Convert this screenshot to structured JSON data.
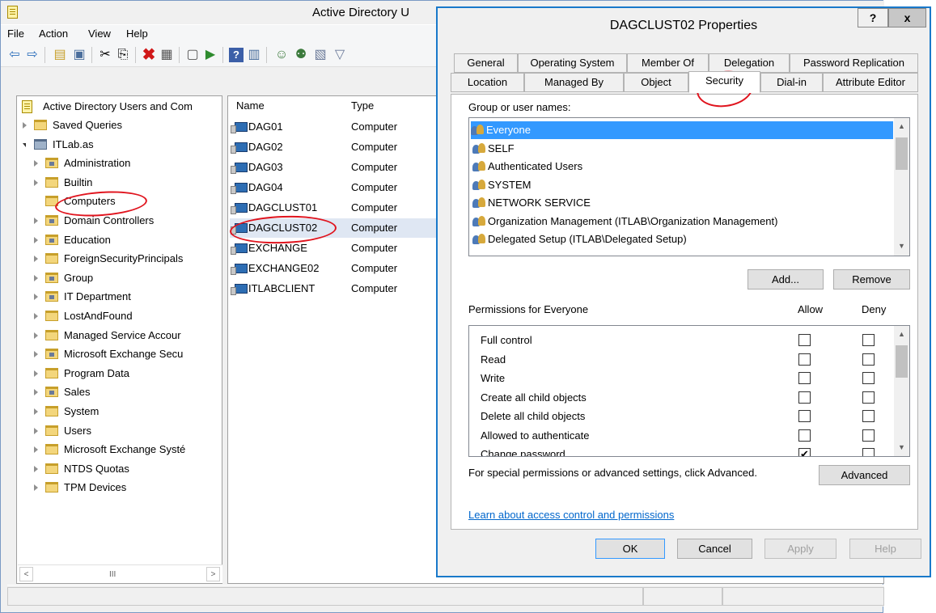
{
  "mmc": {
    "title": "Active Directory U",
    "menu": [
      "File",
      "Action",
      "View",
      "Help"
    ],
    "tree": {
      "root": "Active Directory Users and Com",
      "items": [
        {
          "label": "Saved Queries",
          "level": 1,
          "expander": "closed",
          "icon": "folder"
        },
        {
          "label": "ITLab.as",
          "level": 1,
          "expander": "open",
          "icon": "domain"
        },
        {
          "label": "Administration",
          "level": 2,
          "expander": "closed",
          "icon": "ou"
        },
        {
          "label": "Builtin",
          "level": 2,
          "expander": "closed",
          "icon": "folder"
        },
        {
          "label": "Computers",
          "level": 2,
          "expander": "none",
          "icon": "folder",
          "selected": true
        },
        {
          "label": "Domain Controllers",
          "level": 2,
          "expander": "closed",
          "icon": "ou"
        },
        {
          "label": "Education",
          "level": 2,
          "expander": "closed",
          "icon": "ou"
        },
        {
          "label": "ForeignSecurityPrincipals",
          "level": 2,
          "expander": "closed",
          "icon": "folder"
        },
        {
          "label": "Group",
          "level": 2,
          "expander": "closed",
          "icon": "ou"
        },
        {
          "label": "IT Department",
          "level": 2,
          "expander": "closed",
          "icon": "ou"
        },
        {
          "label": "LostAndFound",
          "level": 2,
          "expander": "closed",
          "icon": "folder"
        },
        {
          "label": "Managed Service Accour",
          "level": 2,
          "expander": "closed",
          "icon": "folder"
        },
        {
          "label": "Microsoft Exchange Secu",
          "level": 2,
          "expander": "closed",
          "icon": "ou"
        },
        {
          "label": "Program Data",
          "level": 2,
          "expander": "closed",
          "icon": "folder"
        },
        {
          "label": "Sales",
          "level": 2,
          "expander": "closed",
          "icon": "ou"
        },
        {
          "label": "System",
          "level": 2,
          "expander": "closed",
          "icon": "folder"
        },
        {
          "label": "Users",
          "level": 2,
          "expander": "closed",
          "icon": "folder"
        },
        {
          "label": "Microsoft Exchange Systé",
          "level": 2,
          "expander": "closed",
          "icon": "folder"
        },
        {
          "label": "NTDS Quotas",
          "level": 2,
          "expander": "closed",
          "icon": "folder"
        },
        {
          "label": "TPM Devices",
          "level": 2,
          "expander": "closed",
          "icon": "folder"
        }
      ],
      "scroll_left": "<",
      "scroll_thumb": "III",
      "scroll_right": ">"
    },
    "list": {
      "col_name": "Name",
      "col_type": "Type",
      "rows": [
        {
          "name": "DAG01",
          "type": "Computer"
        },
        {
          "name": "DAG02",
          "type": "Computer"
        },
        {
          "name": "DAG03",
          "type": "Computer"
        },
        {
          "name": "DAG04",
          "type": "Computer"
        },
        {
          "name": "DAGCLUST01",
          "type": "Computer"
        },
        {
          "name": "DAGCLUST02",
          "type": "Computer",
          "selected": true
        },
        {
          "name": "EXCHANGE",
          "type": "Computer"
        },
        {
          "name": "EXCHANGE02",
          "type": "Computer"
        },
        {
          "name": "ITLABCLIENT",
          "type": "Computer"
        }
      ]
    }
  },
  "dialog": {
    "title": "DAGCLUST02 Properties",
    "help": "?",
    "close": "x",
    "tabs_row1": [
      "General",
      "Operating System",
      "Member Of",
      "Delegation",
      "Password Replication"
    ],
    "tabs_row2": [
      "Location",
      "Managed By",
      "Object",
      "Security",
      "Dial-in",
      "Attribute Editor"
    ],
    "active_tab": "Security",
    "group_label": "Group or user names:",
    "groups": [
      "Everyone",
      "SELF",
      "Authenticated Users",
      "SYSTEM",
      "NETWORK SERVICE",
      "Organization Management (ITLAB\\Organization Management)",
      "Delegated Setup (ITLAB\\Delegated Setup)"
    ],
    "add": "Add...",
    "remove": "Remove",
    "perm_label": "Permissions for Everyone",
    "allow": "Allow",
    "deny": "Deny",
    "permissions": [
      {
        "name": "Full control",
        "allow": false,
        "deny": false
      },
      {
        "name": "Read",
        "allow": false,
        "deny": false
      },
      {
        "name": "Write",
        "allow": false,
        "deny": false
      },
      {
        "name": "Create all child objects",
        "allow": false,
        "deny": false
      },
      {
        "name": "Delete all child objects",
        "allow": false,
        "deny": false
      },
      {
        "name": "Allowed to authenticate",
        "allow": false,
        "deny": false
      },
      {
        "name": "Change password",
        "allow": true,
        "deny": false
      }
    ],
    "advanced_text": "For special permissions or advanced settings, click Advanced.",
    "advanced": "Advanced",
    "link": "Learn about access control and permissions",
    "ok": "OK",
    "cancel": "Cancel",
    "apply": "Apply",
    "help_btn": "Help"
  },
  "colors": {
    "selection": "#3399ff",
    "annotation": "#e0141e",
    "dialog_border": "#1979ca"
  }
}
